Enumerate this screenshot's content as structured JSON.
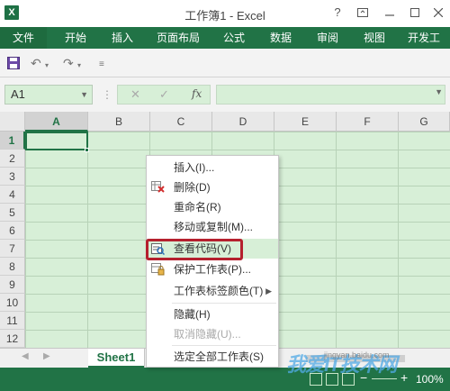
{
  "window": {
    "title": "工作簿1 - Excel",
    "app_icon": "excel-icon",
    "controls": [
      "?",
      "restore-icon",
      "minimize-icon",
      "maximize-icon",
      "close-icon"
    ]
  },
  "ribbon": {
    "tabs": [
      "文件",
      "开始",
      "插入",
      "页面布局",
      "公式",
      "数据",
      "审阅",
      "视图",
      "开发工"
    ]
  },
  "formula_bar": {
    "name_box": "A1",
    "fx": "fx",
    "formula": ""
  },
  "grid": {
    "columns": [
      "A",
      "B",
      "C",
      "D",
      "E",
      "F",
      "G"
    ],
    "rows": [
      "1",
      "2",
      "3",
      "4",
      "5",
      "6",
      "7",
      "8",
      "9",
      "10",
      "11",
      "12"
    ],
    "active_cell": "A1"
  },
  "sheets": {
    "active": "Sheet1"
  },
  "status": {
    "zoom": "100%"
  },
  "context_menu": {
    "items": [
      {
        "label": "插入(I)...",
        "icon": ""
      },
      {
        "label": "删除(D)",
        "icon": "delete-sheet-icon"
      },
      {
        "label": "重命名(R)",
        "icon": ""
      },
      {
        "label": "移动或复制(M)...",
        "icon": ""
      },
      {
        "label": "查看代码(V)",
        "icon": "view-code-icon"
      },
      {
        "label": "保护工作表(P)...",
        "icon": "protect-sheet-icon"
      },
      {
        "label": "工作表标签颜色(T)",
        "icon": ""
      },
      {
        "label": "隐藏(H)",
        "icon": ""
      },
      {
        "label": "取消隐藏(U)...",
        "icon": ""
      },
      {
        "label": "选定全部工作表(S)",
        "icon": ""
      }
    ]
  },
  "watermark": {
    "text": "我爱IT技术网",
    "url": "jingyan.baidu.com"
  },
  "colors": {
    "excel_green": "#217346",
    "grid_fill": "#d7efd7",
    "highlight_border": "#b5202e"
  }
}
